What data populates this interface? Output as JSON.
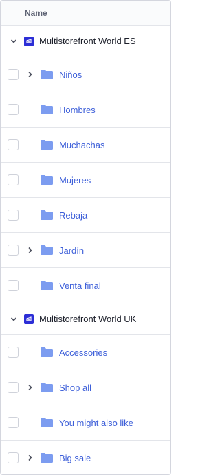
{
  "header": {
    "name_label": "Name"
  },
  "colors": {
    "link": "#3d5fd9",
    "folder": "#7c9cf0",
    "store_icon": "#2c2ed6"
  },
  "groups": [
    {
      "label": "Multistorefront World ES",
      "expanded": true,
      "items": [
        {
          "label": "Niños",
          "has_children": true
        },
        {
          "label": "Hombres",
          "has_children": false
        },
        {
          "label": "Muchachas",
          "has_children": false
        },
        {
          "label": "Mujeres",
          "has_children": false
        },
        {
          "label": "Rebaja",
          "has_children": false
        },
        {
          "label": "Jardín",
          "has_children": true
        },
        {
          "label": "Venta final",
          "has_children": false
        }
      ]
    },
    {
      "label": "Multistorefront World UK",
      "expanded": true,
      "items": [
        {
          "label": "Accessories",
          "has_children": false
        },
        {
          "label": "Shop all",
          "has_children": true
        },
        {
          "label": "You might also like",
          "has_children": false
        },
        {
          "label": "Big sale",
          "has_children": true
        }
      ]
    }
  ]
}
